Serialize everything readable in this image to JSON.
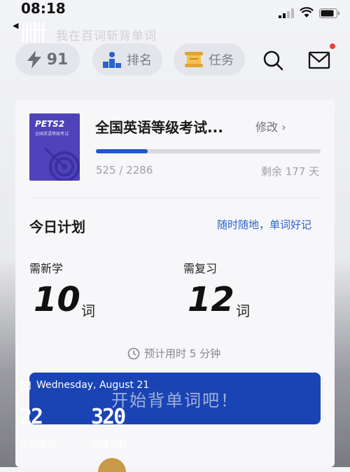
{
  "status_bar": {
    "time": "08:18"
  },
  "back_link": {
    "label": "◀"
  },
  "header": {
    "slogan": "我在百词斩背单词"
  },
  "toolbar": {
    "energy_count": "91",
    "rank_label": "排名",
    "task_label": "任务"
  },
  "book": {
    "cover_code": "PETS2",
    "cover_subtitle": "全国英语等级考试",
    "title": "全国英语等级考试...",
    "edit_label": "修改 ›",
    "progress_text": "525 / 2286",
    "progress_fraction": 0.2297,
    "remaining": "剩余 177 天"
  },
  "plan": {
    "title": "今日计划",
    "slogan_link": "随时随地，单词好记",
    "new_label": "需新学",
    "new_count": "10",
    "review_label": "需复习",
    "review_count": "12",
    "unit": "词",
    "estimate": "预计用时 5 分钟"
  },
  "start_button": {
    "label": "开始背单词吧！"
  },
  "widget": {
    "date": "Wednesday, August 21",
    "today_words": "22",
    "today_words_label": "今日单词",
    "streak_days": "320",
    "streak_days_label": "坚持天数"
  },
  "colors": {
    "accent": "#1f59c9",
    "button": "#1a44b3",
    "book_cover": "#4e43b8",
    "notify": "#e8413c"
  }
}
